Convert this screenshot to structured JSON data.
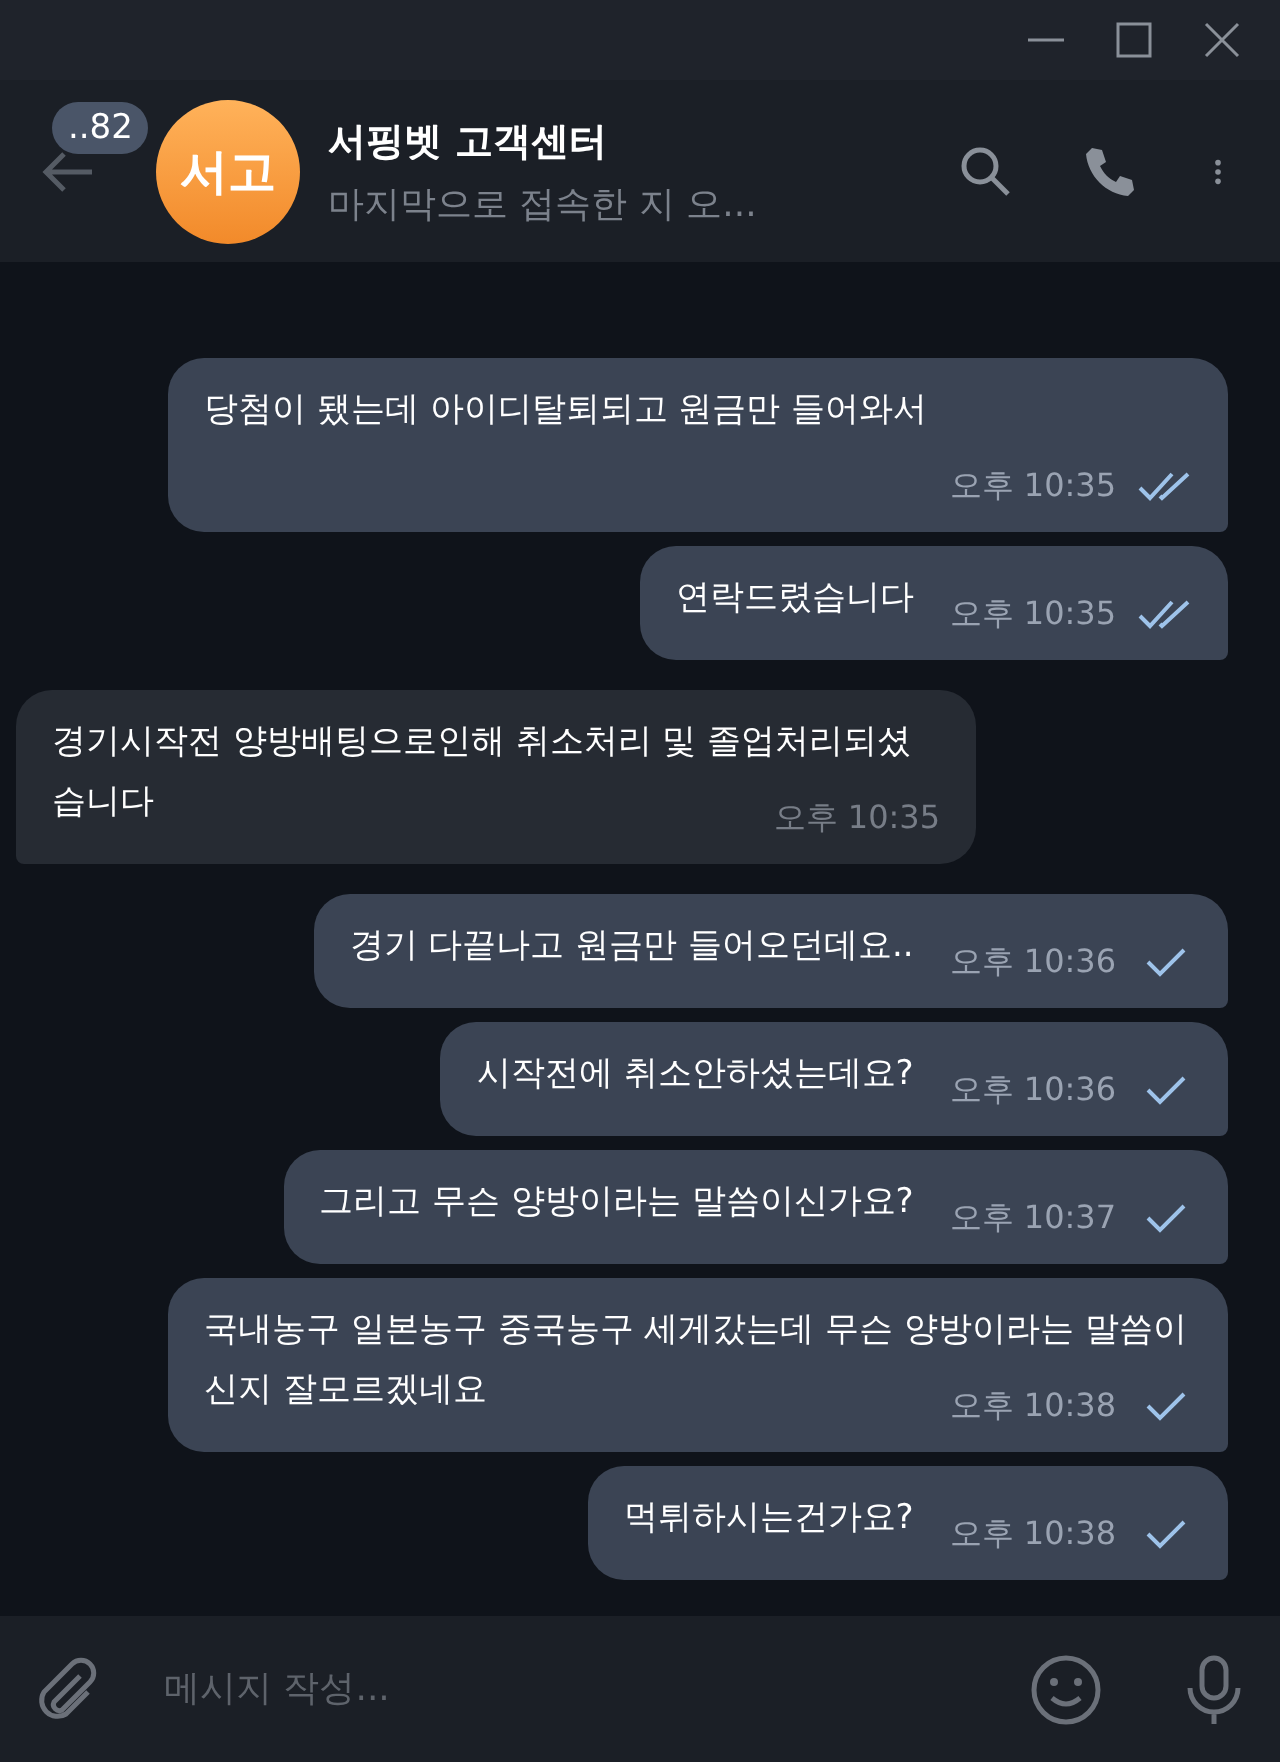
{
  "header": {
    "unread_badge": "..82",
    "avatar_initials": "서고",
    "title": "서핑벳 고객센터",
    "subtitle": "마지막으로 접속한 지 오..."
  },
  "messages": [
    {
      "kind": "outgoing",
      "text": "당첨이 됐는데 아이디탈퇴되고 원금만 들어와서",
      "time": "오후 10:35",
      "read": true
    },
    {
      "kind": "outgoing",
      "text": "연락드렸습니다",
      "time": "오후 10:35",
      "read": true
    },
    {
      "kind": "incoming",
      "text": "경기시작전 양방배팅으로인해 취소처리 및 졸업처리되셨습니다",
      "time": "오후 10:35"
    },
    {
      "kind": "outgoing",
      "text": "경기 다끝나고 원금만 들어오던데요..",
      "time": "오후 10:36",
      "read": false
    },
    {
      "kind": "outgoing",
      "text": "시작전에 취소안하셨는데요?",
      "time": "오후 10:36",
      "read": false
    },
    {
      "kind": "outgoing",
      "text": "그리고 무슨 양방이라는 말씀이신가요?",
      "time": "오후 10:37",
      "read": false
    },
    {
      "kind": "outgoing",
      "text": "국내농구 일본농구 중국농구 세게갔는데 무슨 양방이라는 말씀이신지 잘모르겠네요",
      "time": "오후 10:38",
      "read": false
    },
    {
      "kind": "outgoing",
      "text": "먹튀하시는건가요?",
      "time": "오후 10:38",
      "read": false
    }
  ],
  "composer": {
    "placeholder": "메시지 작성..."
  }
}
